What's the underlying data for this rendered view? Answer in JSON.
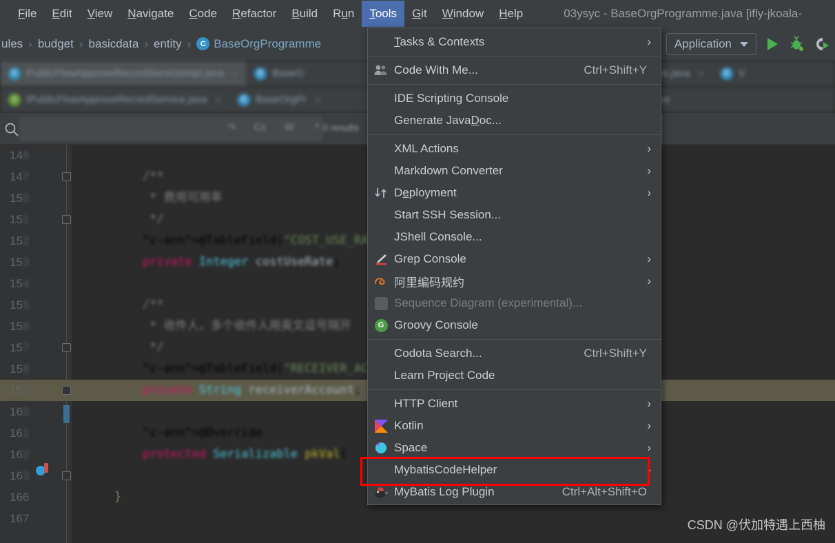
{
  "menubar": {
    "items": [
      {
        "label": "File",
        "mnemonic": "F"
      },
      {
        "label": "Edit",
        "mnemonic": "E"
      },
      {
        "label": "View",
        "mnemonic": "V"
      },
      {
        "label": "Navigate",
        "mnemonic": "N"
      },
      {
        "label": "Code",
        "mnemonic": "C"
      },
      {
        "label": "Refactor",
        "mnemonic": "R"
      },
      {
        "label": "Build",
        "mnemonic": "B"
      },
      {
        "label": "Run",
        "mnemonic": "n"
      },
      {
        "label": "Tools",
        "mnemonic": "T"
      },
      {
        "label": "Git",
        "mnemonic": "G"
      },
      {
        "label": "Window",
        "mnemonic": "W"
      },
      {
        "label": "Help",
        "mnemonic": "H"
      }
    ],
    "active": "Tools",
    "window_title": "03ysyc - BaseOrgProgramme.java [ifly-jkoala-"
  },
  "breadcrumb": {
    "items": [
      "ules",
      "budget",
      "basicdata",
      "entity",
      "BaseOrgProgramme"
    ],
    "class_badge": "C",
    "separator": "›"
  },
  "toolbar": {
    "run_config": "Application",
    "run_icon": "run-play-icon",
    "debug_icon": "debug-bug-icon",
    "coverage_icon": "run-with-coverage-icon",
    "expand_icon": "chevron-right-icon"
  },
  "tabs": {
    "row1": [
      {
        "label": "PublicFlowApproveRecordServiceImpl.java",
        "badge": "C",
        "badge_kind": "c",
        "close": "×"
      },
      {
        "label": "BaseO",
        "badge": "C",
        "badge_kind": "c",
        "close": ""
      },
      {
        "label": "grammeService.java",
        "badge": "",
        "badge_kind": "",
        "close": "×"
      },
      {
        "label": "V",
        "badge": "C",
        "badge_kind": "c",
        "close": ""
      }
    ],
    "row2": [
      {
        "label": "IPublicFlowApproveRecordService.java",
        "badge": "I",
        "badge_kind": "i",
        "close": "×"
      },
      {
        "label": "BaseOrgPr",
        "badge": "C",
        "badge_kind": "c",
        "close": "×"
      },
      {
        "label": "BaseOrgProgramme",
        "badge": "G",
        "badge_kind": "g",
        "close": ""
      }
    ]
  },
  "findbar": {
    "search_icon": "search-icon",
    "search_value": "",
    "history_icon": "history-icon",
    "toggles": [
      "Cc",
      "W",
      ".*"
    ],
    "results": "0 results"
  },
  "editor": {
    "lines": [
      {
        "num": "146",
        "text": "",
        "blur_digits": 1
      },
      {
        "num": "147",
        "text": "    /**",
        "blur_digits": 1,
        "fold": true
      },
      {
        "num": "150",
        "text": "     * 费用可用率",
        "blur_digits": 1
      },
      {
        "num": "151",
        "text": "     */",
        "blur_digits": 1,
        "fold": true
      },
      {
        "num": "152",
        "text": "    @TableField(\"COST_USE_RATE\")",
        "blur_digits": 1
      },
      {
        "num": "153",
        "text": "    private Integer costUseRate;",
        "blur_digits": 1
      },
      {
        "num": "154",
        "text": "",
        "blur_digits": 1
      },
      {
        "num": "155",
        "text": "    /**",
        "blur_digits": 1,
        "fold": true
      },
      {
        "num": "156",
        "text": "     * 收件人，多个收件人用英文逗号隔开",
        "blur_digits": 1
      },
      {
        "num": "157",
        "text": "     */",
        "blur_digits": 1,
        "fold": true
      },
      {
        "num": "158",
        "text": "    @TableField(\"RECEIVER_ACCOUNT\")",
        "blur_digits": 1
      },
      {
        "num": "159",
        "text": "    private String receiverAccount;",
        "blur_digits": 1,
        "highlight": true
      },
      {
        "num": "160",
        "text": "",
        "blur_digits": 1
      },
      {
        "num": "161",
        "text": "    @Override",
        "blur_digits": 1
      },
      {
        "num": "162",
        "text": "    protected Serializable pkVal(",
        "blur_digits": 1,
        "breakpoint": true
      },
      {
        "num": "163",
        "text": "",
        "blur_digits": 1
      },
      {
        "num": "166",
        "text": "}",
        "blur_digits": 0,
        "sharp": true
      },
      {
        "num": "167",
        "text": "",
        "blur_digits": 0
      }
    ]
  },
  "tools_menu": {
    "sections": [
      [
        {
          "label": "Tasks & Contexts",
          "mnemonic": "T",
          "icon": "",
          "shortcut": "",
          "submenu": true,
          "state": "normal"
        }
      ],
      [
        {
          "label": "Code With Me...",
          "icon": "people-icon",
          "shortcut": "Ctrl+Shift+Y",
          "submenu": false,
          "state": "normal"
        }
      ],
      [
        {
          "label": "IDE Scripting Console",
          "icon": "",
          "shortcut": "",
          "submenu": false,
          "state": "normal"
        },
        {
          "label": "Generate JavaDoc...",
          "mnemonic": "D",
          "icon": "",
          "shortcut": "",
          "submenu": false,
          "state": "normal"
        }
      ],
      [
        {
          "label": "XML Actions",
          "icon": "",
          "shortcut": "",
          "submenu": true,
          "state": "normal"
        },
        {
          "label": "Markdown Converter",
          "icon": "",
          "shortcut": "",
          "submenu": true,
          "state": "normal"
        },
        {
          "label": "Deployment",
          "mnemonic": "e",
          "icon": "deployment-updown-icon",
          "shortcut": "",
          "submenu": true,
          "state": "normal"
        },
        {
          "label": "Start SSH Session...",
          "icon": "",
          "shortcut": "",
          "submenu": false,
          "state": "normal"
        },
        {
          "label": "JShell Console...",
          "icon": "",
          "shortcut": "",
          "submenu": false,
          "state": "normal"
        },
        {
          "label": "Grep Console",
          "icon": "grep-console-icon",
          "shortcut": "",
          "submenu": true,
          "state": "normal"
        },
        {
          "label": "阿里编码规约",
          "icon": "alibaba-icon",
          "shortcut": "",
          "submenu": true,
          "state": "normal"
        },
        {
          "label": "Sequence Diagram (experimental)...",
          "icon": "square-gray-icon",
          "shortcut": "",
          "submenu": false,
          "state": "disabled"
        },
        {
          "label": "Groovy Console",
          "icon": "groovy-icon",
          "shortcut": "",
          "submenu": false,
          "state": "normal"
        }
      ],
      [
        {
          "label": "Codota Search...",
          "icon": "",
          "shortcut": "Ctrl+Shift+Y",
          "submenu": false,
          "state": "normal"
        },
        {
          "label": "Learn Project Code",
          "icon": "",
          "shortcut": "",
          "submenu": false,
          "state": "normal"
        }
      ],
      [
        {
          "label": "HTTP Client",
          "icon": "",
          "shortcut": "",
          "submenu": true,
          "state": "normal"
        },
        {
          "label": "Kotlin",
          "icon": "kotlin-icon",
          "shortcut": "",
          "submenu": true,
          "state": "normal"
        },
        {
          "label": "Space",
          "icon": "space-icon",
          "shortcut": "",
          "submenu": true,
          "state": "normal"
        },
        {
          "label": "MybatisCodeHelper",
          "icon": "",
          "shortcut": "",
          "submenu": true,
          "state": "normal"
        },
        {
          "label": "MyBatis Log Plugin",
          "icon": "mybatis-log-icon",
          "shortcut": "Ctrl+Alt+Shift+O",
          "submenu": false,
          "state": "highlighted"
        }
      ]
    ],
    "submenu_arrow": "›"
  },
  "annotation": {
    "highlight_color": "#ff0000",
    "target_item": "MyBatis Log Plugin"
  },
  "watermark": {
    "text": "CSDN @伏加特遇上西柚"
  },
  "colors": {
    "menu_bg": "#3c3f41",
    "editor_bg": "#2b2b2b",
    "gutter_bg": "#313335",
    "accent_blue": "#4b6eaf",
    "highlight_line": "#5d5b48"
  }
}
